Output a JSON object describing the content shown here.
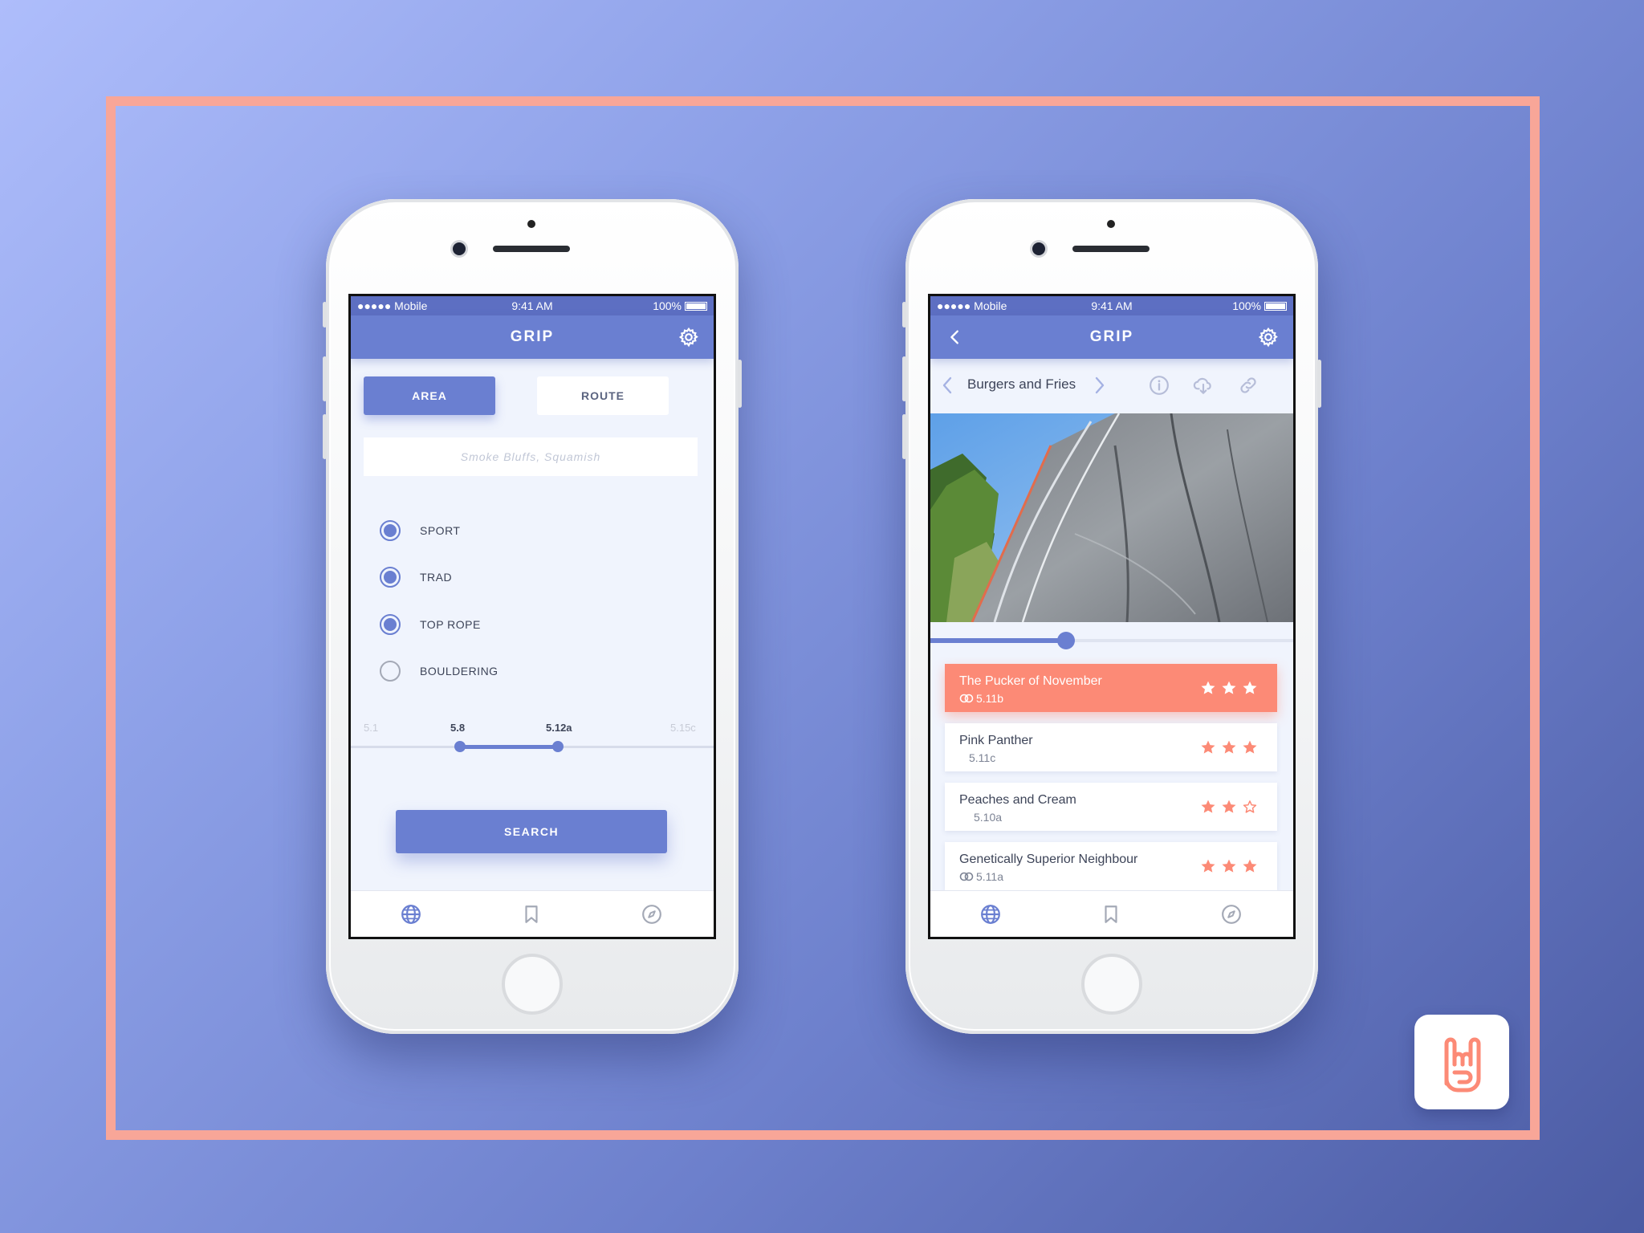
{
  "colors": {
    "primary": "#6a7fd1",
    "accent": "#fc8a76",
    "border": "#f8a698"
  },
  "status_bar": {
    "carrier": "●●●●● Mobile",
    "time": "9:41 AM",
    "battery": "100%"
  },
  "app": {
    "title": "GRIP"
  },
  "search_screen": {
    "segments": {
      "area": "AREA",
      "route": "ROUTE"
    },
    "search_placeholder": "Smoke Bluffs, Squamish",
    "climb_types": [
      {
        "label": "SPORT",
        "selected": true
      },
      {
        "label": "TRAD",
        "selected": true
      },
      {
        "label": "TOP ROPE",
        "selected": true
      },
      {
        "label": "BOULDERING",
        "selected": false
      }
    ],
    "grade_range": {
      "min": "5.1",
      "low": "5.8",
      "high": "5.12a",
      "max": "5.15c"
    },
    "search_button": "SEARCH"
  },
  "route_screen": {
    "area_name": "Burgers and Fries",
    "photo_slider_fraction": 0.37,
    "routes": [
      {
        "name": "The Pucker of November",
        "grade": "5.11b",
        "stars": 3,
        "rope_icon": true,
        "active": true
      },
      {
        "name": "Pink Panther",
        "grade": "5.11c",
        "stars": 3,
        "rope_icon": false,
        "active": false
      },
      {
        "name": "Peaches and Cream",
        "grade": "5.10a",
        "stars": 2,
        "rope_icon": false,
        "active": false
      },
      {
        "name": "Genetically Superior Neighbour",
        "grade": "5.11a",
        "stars": 3,
        "rope_icon": true,
        "active": false
      }
    ]
  },
  "tabs": [
    "globe-icon",
    "bookmark-icon",
    "compass-icon"
  ]
}
